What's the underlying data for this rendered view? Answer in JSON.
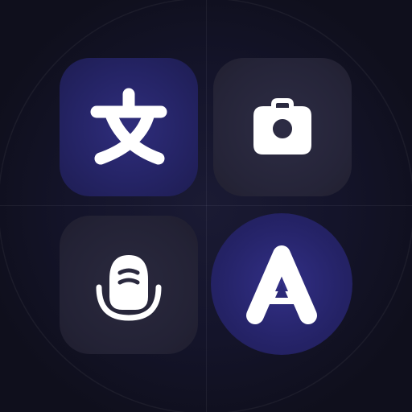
{
  "tiles": [
    {
      "id": "text",
      "icon": "chinese-character-icon"
    },
    {
      "id": "camera",
      "icon": "camera-icon"
    },
    {
      "id": "voice",
      "icon": "microphone-icon"
    },
    {
      "id": "letter",
      "icon": "letter-a-icon"
    }
  ],
  "colors": {
    "background": "#0f0f1c",
    "accent": "#26246a",
    "tile_neutral": "#252438",
    "icon": "#ffffff"
  }
}
